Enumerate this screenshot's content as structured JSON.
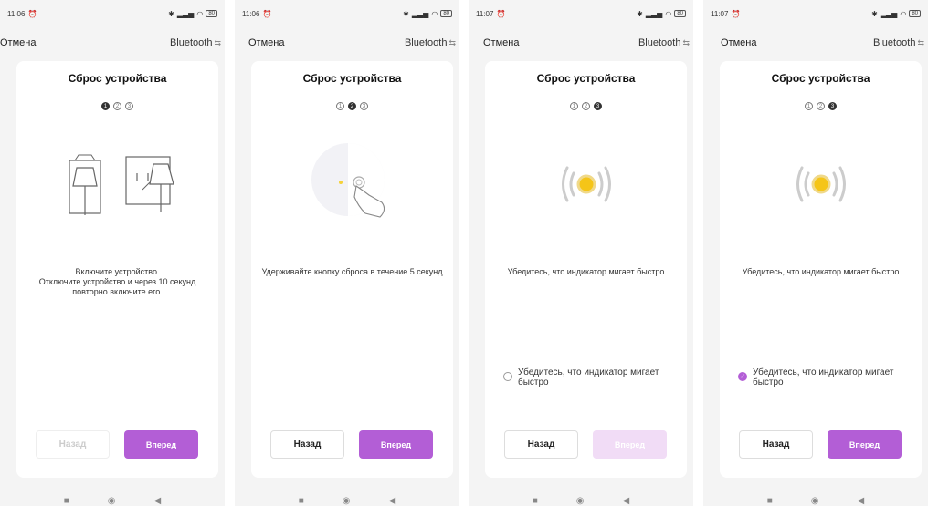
{
  "colors": {
    "accent": "#b35ed6",
    "accent_disabled": "#f1dcf6",
    "led": "#f5c518"
  },
  "screens": [
    {
      "time": "11:06",
      "battery": "80",
      "cancel": "Отмена",
      "bluetooth": "Bluetooth",
      "title": "Сброс устройства",
      "steps": [
        "1",
        "2",
        "3"
      ],
      "active_step": 1,
      "illustration": "plug-socket-icon",
      "instruction": "Включите устройство.\nОтключите устройство и через 10 секунд повторно включите его.",
      "confirm_text": "",
      "confirm_checked": false,
      "back": "Назад",
      "back_enabled": false,
      "next": "Вперед",
      "next_enabled": true
    },
    {
      "time": "11:06",
      "battery": "80",
      "cancel": "Отмена",
      "bluetooth": "Bluetooth",
      "title": "Сброс устройства",
      "steps": [
        "1",
        "2",
        "3"
      ],
      "active_step": 2,
      "illustration": "reset-button-press-icon",
      "instruction": "Удерживайте кнопку сброса в течение 5 секунд",
      "confirm_text": "",
      "confirm_checked": false,
      "back": "Назад",
      "back_enabled": true,
      "next": "Вперед",
      "next_enabled": true
    },
    {
      "time": "11:07",
      "battery": "80",
      "cancel": "Отмена",
      "bluetooth": "Bluetooth",
      "title": "Сброс устройства",
      "steps": [
        "1",
        "2",
        "3"
      ],
      "active_step": 3,
      "illustration": "blinking-led-icon",
      "instruction": "Убедитесь, что индикатор мигает быстро",
      "confirm_text": "Убедитесь, что индикатор мигает быстро",
      "confirm_checked": false,
      "back": "Назад",
      "back_enabled": true,
      "next": "Вперед",
      "next_enabled": false
    },
    {
      "time": "11:07",
      "battery": "80",
      "cancel": "Отмена",
      "bluetooth": "Bluetooth",
      "title": "Сброс устройства",
      "steps": [
        "1",
        "2",
        "3"
      ],
      "active_step": 3,
      "illustration": "blinking-led-icon",
      "instruction": "Убедитесь, что индикатор мигает быстро",
      "confirm_text": "Убедитесь, что индикатор мигает быстро",
      "confirm_checked": true,
      "back": "Назад",
      "back_enabled": true,
      "next": "Вперед",
      "next_enabled": true
    }
  ]
}
